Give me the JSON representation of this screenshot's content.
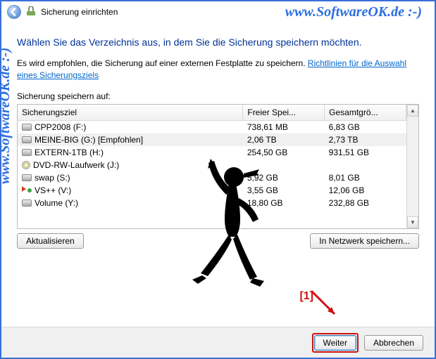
{
  "titlebar": {
    "title": "Sicherung einrichten"
  },
  "heading": "Wählen Sie das Verzeichnis aus, in dem Sie die Sicherung speichern möchten.",
  "desc_prefix": "Es wird empfohlen, die Sicherung auf einer externen Festplatte zu speichern. ",
  "desc_link": "Richtlinien für die Auswahl eines Sicherungsziels",
  "sublabel": "Sicherung speichern auf:",
  "columns": {
    "target": "Sicherungsziel",
    "free": "Freier Spei...",
    "total": "Gesamtgrö..."
  },
  "rows": [
    {
      "icon": "drive",
      "name": "CPP2008 (F:)",
      "free": "738,61 MB",
      "total": "6,83 GB",
      "selected": false
    },
    {
      "icon": "drive",
      "name": "MEINE-BIG (G:) [Empfohlen]",
      "free": "2,06 TB",
      "total": "2,73 TB",
      "selected": true
    },
    {
      "icon": "drive",
      "name": "EXTERN-1TB (H:)",
      "free": "254,50 GB",
      "total": "931,51 GB",
      "selected": false
    },
    {
      "icon": "dvd",
      "name": "DVD-RW-Laufwerk (J:)",
      "free": "",
      "total": "",
      "selected": false
    },
    {
      "icon": "drive",
      "name": "swap (S:)",
      "free": "5,92 GB",
      "total": "8,01 GB",
      "selected": false
    },
    {
      "icon": "vs",
      "name": "VS++ (V:)",
      "free": "3,55 GB",
      "total": "12,06 GB",
      "selected": false
    },
    {
      "icon": "drive",
      "name": "Volume (Y:)",
      "free": "18,80 GB",
      "total": "232,88 GB",
      "selected": false
    }
  ],
  "buttons": {
    "refresh": "Aktualisieren",
    "network": "In Netzwerk speichern...",
    "next": "Weiter",
    "cancel": "Abbrechen"
  },
  "watermark": "www.SoftwareOK.de :-)",
  "annotation_num": "[1]"
}
